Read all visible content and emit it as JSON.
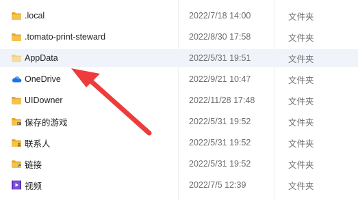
{
  "files": [
    {
      "name": ".local",
      "modified": "2022/7/18 14:00",
      "type": "文件夹",
      "icon": "folder-icon"
    },
    {
      "name": ".tomato-print-steward",
      "modified": "2022/8/30 17:58",
      "type": "文件夹",
      "icon": "folder-icon"
    },
    {
      "name": "AppData",
      "modified": "2022/5/31 19:51",
      "type": "文件夹",
      "icon": "folder-icon",
      "hidden": true
    },
    {
      "name": "OneDrive",
      "modified": "2022/9/21 10:47",
      "type": "文件夹",
      "icon": "onedrive-cloud-icon"
    },
    {
      "name": "UIDowner",
      "modified": "2022/11/28 17:48",
      "type": "文件夹",
      "icon": "folder-icon"
    },
    {
      "name": "保存的游戏",
      "modified": "2022/5/31 19:52",
      "type": "文件夹",
      "icon": "saved-games-folder-icon"
    },
    {
      "name": "联系人",
      "modified": "2022/5/31 19:52",
      "type": "文件夹",
      "icon": "contacts-folder-icon"
    },
    {
      "name": "链接",
      "modified": "2022/5/31 19:52",
      "type": "文件夹",
      "icon": "links-folder-icon"
    },
    {
      "name": "视频",
      "modified": "2022/7/5 12:39",
      "type": "文件夹",
      "icon": "videos-folder-icon"
    }
  ],
  "colors": {
    "folder": "#f4c24d",
    "folder_dark": "#e6a82b",
    "hidden_folder": "#f6dd9c",
    "onedrive": "#1a73e8",
    "video": "#7a4fd6",
    "arrow": "#ee3b3b",
    "highlight_row": "#f0f4fa"
  },
  "annotation": {
    "type": "red-arrow",
    "points_to": "AppData"
  }
}
